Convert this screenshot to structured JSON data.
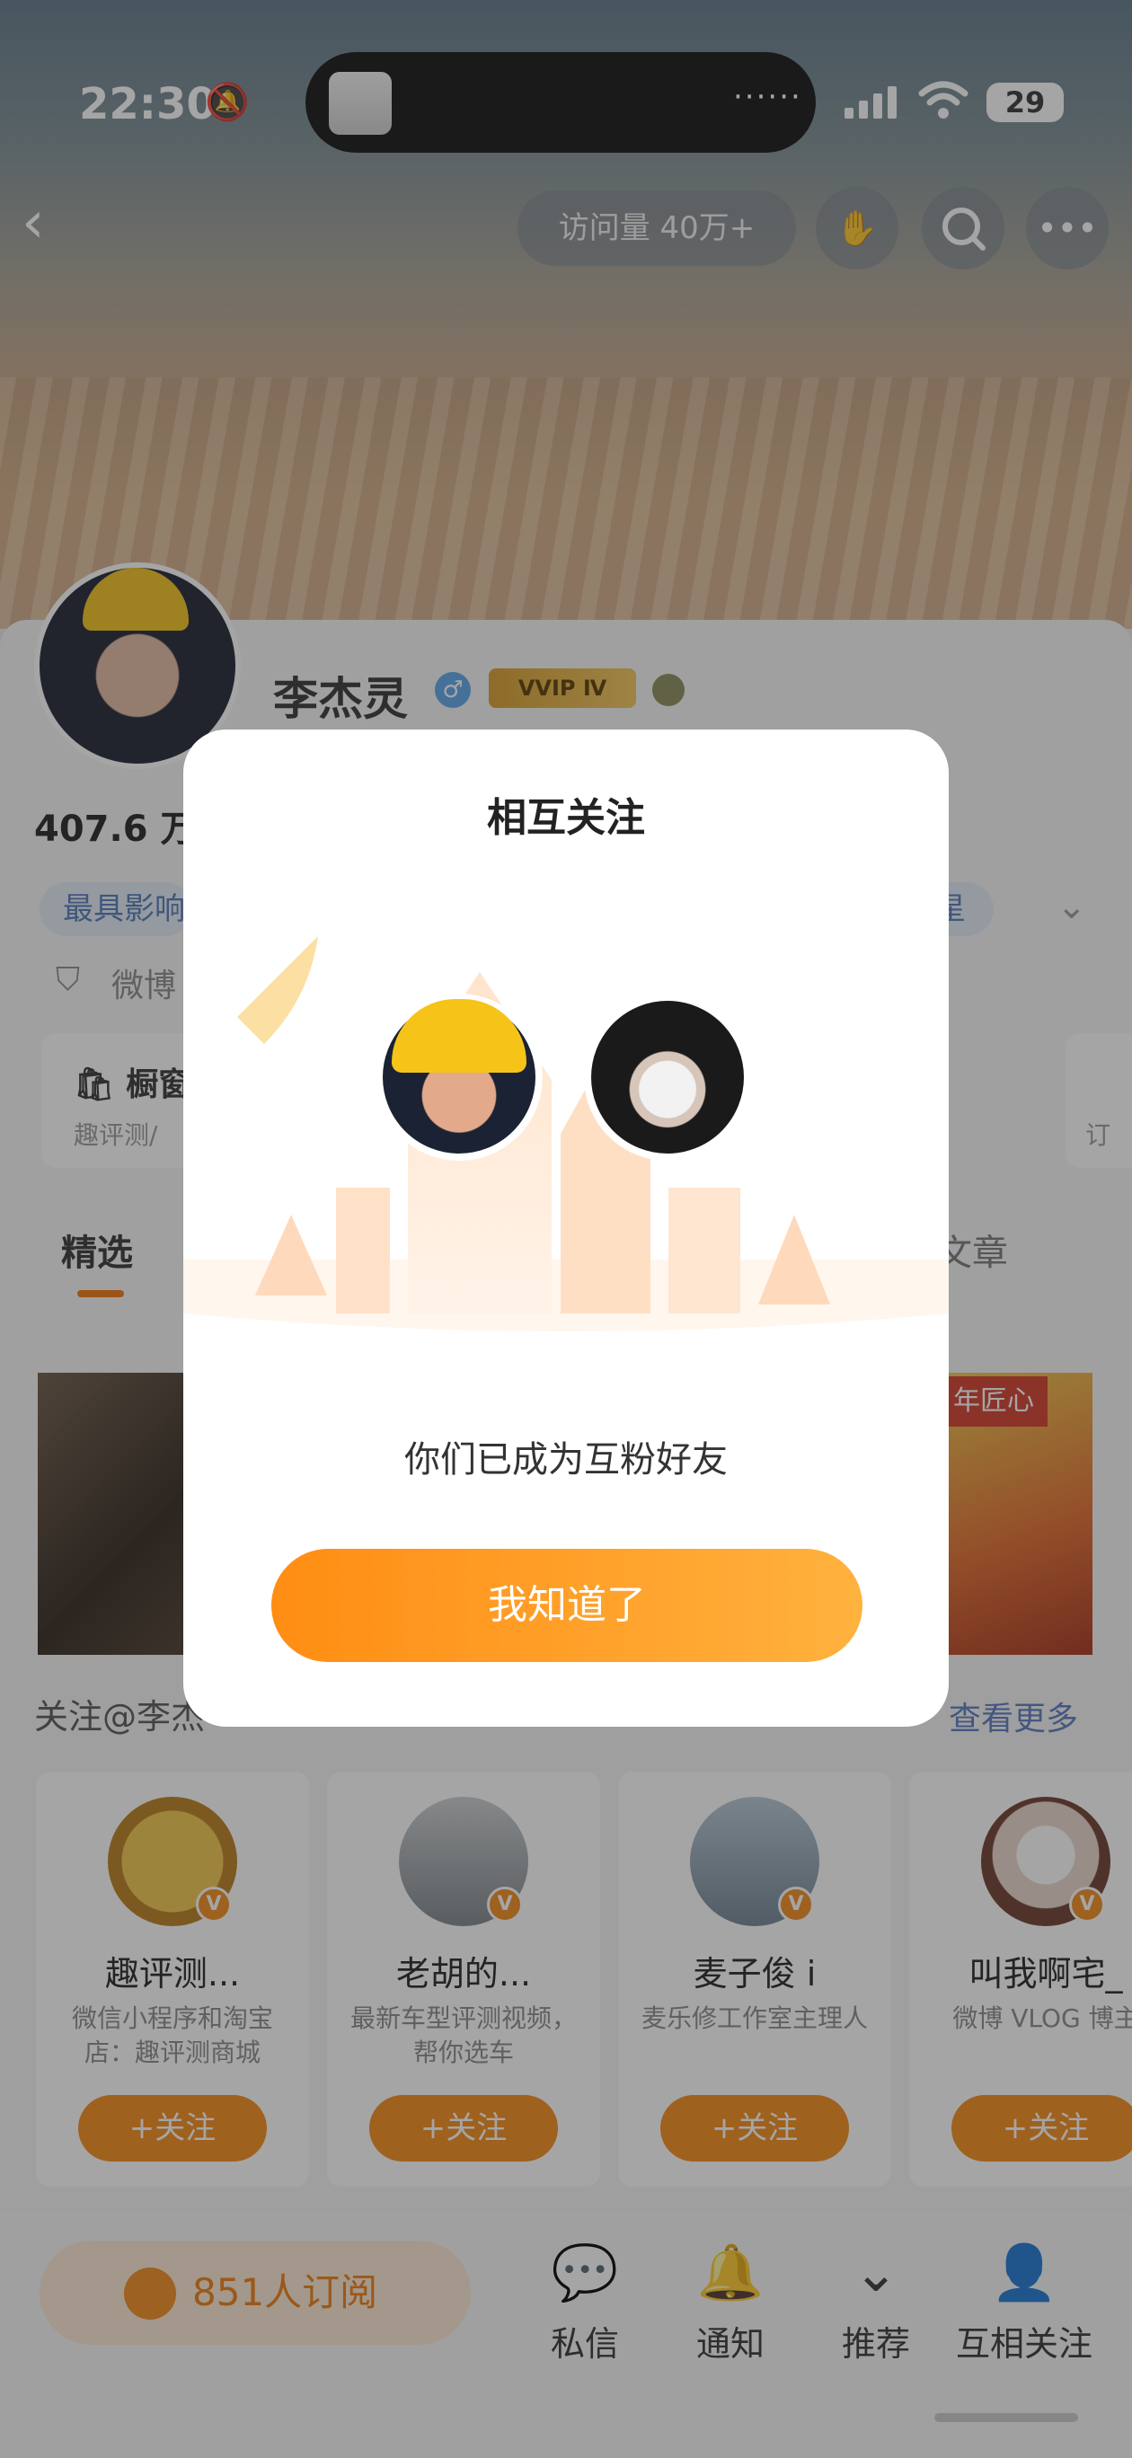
{
  "status_bar": {
    "time": "22:30",
    "battery": "29"
  },
  "header": {
    "visits": "访问量 40万+"
  },
  "profile": {
    "name": "李杰灵",
    "gender_icon": "♂",
    "vip": "VVIP Ⅳ",
    "fans_count": "407.6 万",
    "tag_left": "最具影响",
    "tag_right": "星",
    "weibo_line": "微博",
    "window_label": "橱窗",
    "window_sub": "趣评测/",
    "right_card_sub": "订"
  },
  "tabs": {
    "selected": "精选",
    "articles": "文章"
  },
  "content": {
    "image_badge": "年匠心"
  },
  "follow_section": {
    "title": "关注@李杰",
    "more": "查看更多",
    "cards": [
      {
        "name": "趣评测...",
        "desc": "微信小程序和淘宝店：趣评测商城",
        "button": "+关注",
        "avatar_color": "#e8b23a"
      },
      {
        "name": "老胡的...",
        "desc": "最新车型评测视频，帮你选车",
        "button": "+关注",
        "avatar_color": "#9aa3a7"
      },
      {
        "name": "麦子俊 i",
        "desc": "麦乐修工作室主理人",
        "button": "+关注",
        "avatar_color": "#8ea2b4"
      },
      {
        "name": "叫我啊宅_",
        "desc": "微博 VLOG 博主",
        "button": "+关注",
        "avatar_color": "#e9e2dc"
      }
    ]
  },
  "bottom_bar": {
    "subscribe": "851人订阅",
    "items": [
      {
        "label": "私信",
        "icon": "message-icon"
      },
      {
        "label": "通知",
        "icon": "bell-icon"
      },
      {
        "label": "推荐",
        "icon": "recommend-icon"
      },
      {
        "label": "互相关注",
        "icon": "mutual-follow-icon"
      }
    ]
  },
  "modal": {
    "title": "相互关注",
    "message": "你们已成为互粉好友",
    "button": "我知道了"
  },
  "colors": {
    "accent": "#f48a17",
    "link": "#5979c1",
    "tag_bg": "#e4ecf7"
  }
}
